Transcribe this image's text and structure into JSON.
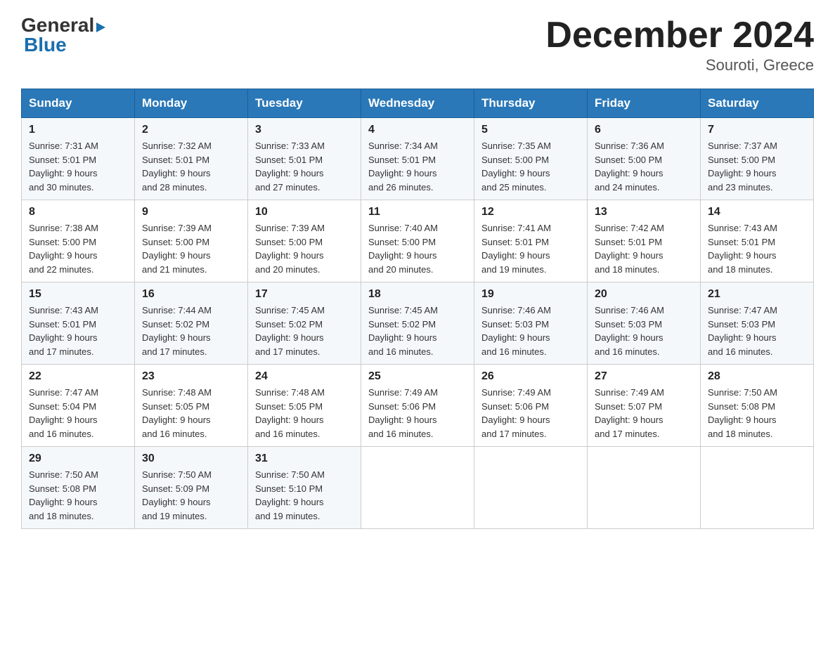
{
  "header": {
    "logo": {
      "general": "General",
      "triangle": "▶",
      "blue": "Blue"
    },
    "title": "December 2024",
    "subtitle": "Souroti, Greece"
  },
  "weekdays": [
    "Sunday",
    "Monday",
    "Tuesday",
    "Wednesday",
    "Thursday",
    "Friday",
    "Saturday"
  ],
  "weeks": [
    [
      {
        "day": "1",
        "sunrise": "7:31 AM",
        "sunset": "5:01 PM",
        "daylight": "9 hours and 30 minutes."
      },
      {
        "day": "2",
        "sunrise": "7:32 AM",
        "sunset": "5:01 PM",
        "daylight": "9 hours and 28 minutes."
      },
      {
        "day": "3",
        "sunrise": "7:33 AM",
        "sunset": "5:01 PM",
        "daylight": "9 hours and 27 minutes."
      },
      {
        "day": "4",
        "sunrise": "7:34 AM",
        "sunset": "5:01 PM",
        "daylight": "9 hours and 26 minutes."
      },
      {
        "day": "5",
        "sunrise": "7:35 AM",
        "sunset": "5:00 PM",
        "daylight": "9 hours and 25 minutes."
      },
      {
        "day": "6",
        "sunrise": "7:36 AM",
        "sunset": "5:00 PM",
        "daylight": "9 hours and 24 minutes."
      },
      {
        "day": "7",
        "sunrise": "7:37 AM",
        "sunset": "5:00 PM",
        "daylight": "9 hours and 23 minutes."
      }
    ],
    [
      {
        "day": "8",
        "sunrise": "7:38 AM",
        "sunset": "5:00 PM",
        "daylight": "9 hours and 22 minutes."
      },
      {
        "day": "9",
        "sunrise": "7:39 AM",
        "sunset": "5:00 PM",
        "daylight": "9 hours and 21 minutes."
      },
      {
        "day": "10",
        "sunrise": "7:39 AM",
        "sunset": "5:00 PM",
        "daylight": "9 hours and 20 minutes."
      },
      {
        "day": "11",
        "sunrise": "7:40 AM",
        "sunset": "5:00 PM",
        "daylight": "9 hours and 20 minutes."
      },
      {
        "day": "12",
        "sunrise": "7:41 AM",
        "sunset": "5:01 PM",
        "daylight": "9 hours and 19 minutes."
      },
      {
        "day": "13",
        "sunrise": "7:42 AM",
        "sunset": "5:01 PM",
        "daylight": "9 hours and 18 minutes."
      },
      {
        "day": "14",
        "sunrise": "7:43 AM",
        "sunset": "5:01 PM",
        "daylight": "9 hours and 18 minutes."
      }
    ],
    [
      {
        "day": "15",
        "sunrise": "7:43 AM",
        "sunset": "5:01 PM",
        "daylight": "9 hours and 17 minutes."
      },
      {
        "day": "16",
        "sunrise": "7:44 AM",
        "sunset": "5:02 PM",
        "daylight": "9 hours and 17 minutes."
      },
      {
        "day": "17",
        "sunrise": "7:45 AM",
        "sunset": "5:02 PM",
        "daylight": "9 hours and 17 minutes."
      },
      {
        "day": "18",
        "sunrise": "7:45 AM",
        "sunset": "5:02 PM",
        "daylight": "9 hours and 16 minutes."
      },
      {
        "day": "19",
        "sunrise": "7:46 AM",
        "sunset": "5:03 PM",
        "daylight": "9 hours and 16 minutes."
      },
      {
        "day": "20",
        "sunrise": "7:46 AM",
        "sunset": "5:03 PM",
        "daylight": "9 hours and 16 minutes."
      },
      {
        "day": "21",
        "sunrise": "7:47 AM",
        "sunset": "5:03 PM",
        "daylight": "9 hours and 16 minutes."
      }
    ],
    [
      {
        "day": "22",
        "sunrise": "7:47 AM",
        "sunset": "5:04 PM",
        "daylight": "9 hours and 16 minutes."
      },
      {
        "day": "23",
        "sunrise": "7:48 AM",
        "sunset": "5:05 PM",
        "daylight": "9 hours and 16 minutes."
      },
      {
        "day": "24",
        "sunrise": "7:48 AM",
        "sunset": "5:05 PM",
        "daylight": "9 hours and 16 minutes."
      },
      {
        "day": "25",
        "sunrise": "7:49 AM",
        "sunset": "5:06 PM",
        "daylight": "9 hours and 16 minutes."
      },
      {
        "day": "26",
        "sunrise": "7:49 AM",
        "sunset": "5:06 PM",
        "daylight": "9 hours and 17 minutes."
      },
      {
        "day": "27",
        "sunrise": "7:49 AM",
        "sunset": "5:07 PM",
        "daylight": "9 hours and 17 minutes."
      },
      {
        "day": "28",
        "sunrise": "7:50 AM",
        "sunset": "5:08 PM",
        "daylight": "9 hours and 18 minutes."
      }
    ],
    [
      {
        "day": "29",
        "sunrise": "7:50 AM",
        "sunset": "5:08 PM",
        "daylight": "9 hours and 18 minutes."
      },
      {
        "day": "30",
        "sunrise": "7:50 AM",
        "sunset": "5:09 PM",
        "daylight": "9 hours and 19 minutes."
      },
      {
        "day": "31",
        "sunrise": "7:50 AM",
        "sunset": "5:10 PM",
        "daylight": "9 hours and 19 minutes."
      },
      null,
      null,
      null,
      null
    ]
  ],
  "labels": {
    "sunrise": "Sunrise:",
    "sunset": "Sunset:",
    "daylight": "Daylight:"
  }
}
